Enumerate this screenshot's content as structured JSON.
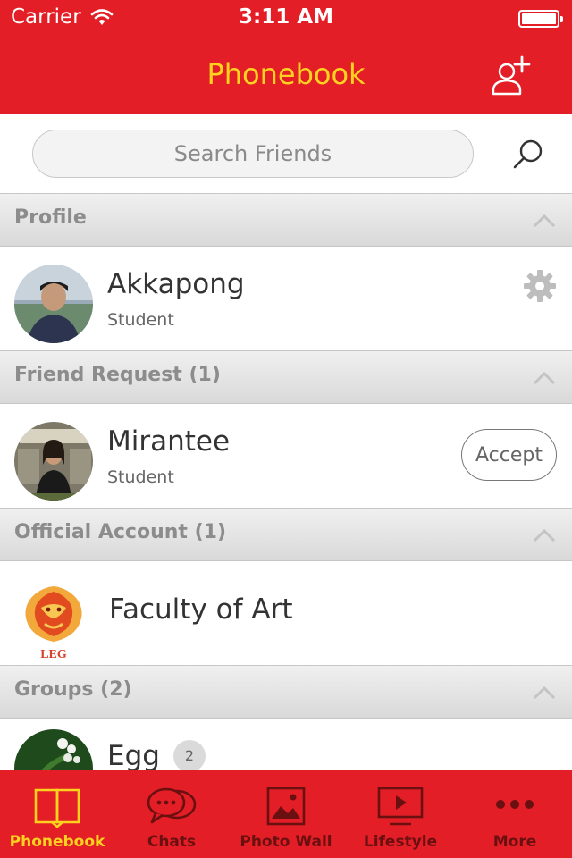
{
  "status": {
    "carrier": "Carrier",
    "time": "3:11 AM"
  },
  "nav": {
    "title": "Phonebook"
  },
  "search": {
    "placeholder": "Search Friends"
  },
  "sections": {
    "profile": {
      "title": "Profile"
    },
    "friend_request": {
      "title": "Friend  Request  (1)"
    },
    "official": {
      "title": "Official  Account  (1)"
    },
    "groups": {
      "title": "Groups  (2)"
    }
  },
  "profile": {
    "name": "Akkapong",
    "role": "Student"
  },
  "friend_request": {
    "name": "Mirantee",
    "role": "Student",
    "accept_label": "Accept"
  },
  "official": {
    "name": "Faculty of Art"
  },
  "group": {
    "name": "Egg",
    "count": "2"
  },
  "tabs": [
    {
      "label": "Phonebook",
      "icon": "book-icon",
      "active": true
    },
    {
      "label": "Chats",
      "icon": "chat-icon",
      "active": false
    },
    {
      "label": "Photo  Wall",
      "icon": "photo-icon",
      "active": false
    },
    {
      "label": "Lifestyle",
      "icon": "tv-play-icon",
      "active": false
    },
    {
      "label": "More",
      "icon": "more-icon",
      "active": false
    }
  ],
  "colors": {
    "brand_red": "#e31e26",
    "accent_yellow": "#ffd21f",
    "tab_inactive": "#6a1010"
  }
}
